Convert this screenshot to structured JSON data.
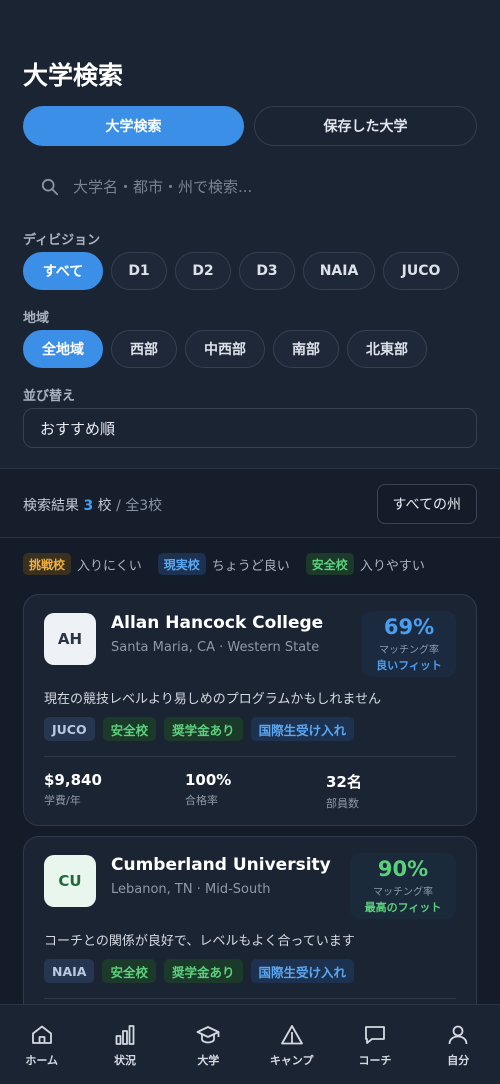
{
  "header": {
    "title": "大学検索"
  },
  "segments": {
    "search": "大学検索",
    "saved": "保存した大学"
  },
  "search": {
    "placeholder": "大学名・都市・州で検索..."
  },
  "division": {
    "label": "ディビジョン",
    "options": [
      "すべて",
      "D1",
      "D2",
      "D3",
      "NAIA",
      "JUCO"
    ],
    "selected": "すべて"
  },
  "region": {
    "label": "地域",
    "options": [
      "全地域",
      "西部",
      "中西部",
      "南部",
      "北東部"
    ],
    "selected": "全地域"
  },
  "sort": {
    "label": "並び替え",
    "value": "おすすめ順"
  },
  "results": {
    "prefix": "検索結果",
    "count": "3",
    "unit": "校",
    "total": "/ 全3校",
    "state_button": "すべての州"
  },
  "legend": [
    {
      "tag": "挑戦校",
      "desc": "入りにくい"
    },
    {
      "tag": "現実校",
      "desc": "ちょうど良い"
    },
    {
      "tag": "安全校",
      "desc": "入りやすい"
    }
  ],
  "colleges": [
    {
      "initials": "AH",
      "name": "Allan Hancock College",
      "location": "Santa Maria, CA · Western State",
      "match_pct": "69%",
      "match_label": "マッチング率",
      "match_word": "良いフィット",
      "description": "現在の競技レベルより易しめのプログラムかもしれません",
      "tags": [
        "JUCO",
        "安全校",
        "奨学金あり",
        "国際生受け入れ"
      ],
      "stats": [
        {
          "value": "$9,840",
          "label": "学費/年"
        },
        {
          "value": "100%",
          "label": "合格率"
        },
        {
          "value": "32名",
          "label": "部員数"
        }
      ]
    },
    {
      "initials": "CU",
      "name": "Cumberland University",
      "location": "Lebanon, TN · Mid-South",
      "match_pct": "90%",
      "match_label": "マッチング率",
      "match_word": "最高のフィット",
      "description": "コーチとの関係が良好で、レベルもよく合っています",
      "tags": [
        "NAIA",
        "安全校",
        "奨学金あり",
        "国際生受け入れ"
      ]
    }
  ],
  "nav": [
    {
      "label": "ホーム",
      "icon": "home-icon"
    },
    {
      "label": "状況",
      "icon": "bar-chart-icon"
    },
    {
      "label": "大学",
      "icon": "graduation-cap-icon"
    },
    {
      "label": "キャンプ",
      "icon": "tent-icon"
    },
    {
      "label": "コーチ",
      "icon": "chat-bubble-icon"
    },
    {
      "label": "自分",
      "icon": "user-icon"
    }
  ],
  "colors": {
    "accent": "#3b8fe6",
    "safe": "#5ccf7c",
    "reach": "#f0b040",
    "background": "#141c29"
  }
}
